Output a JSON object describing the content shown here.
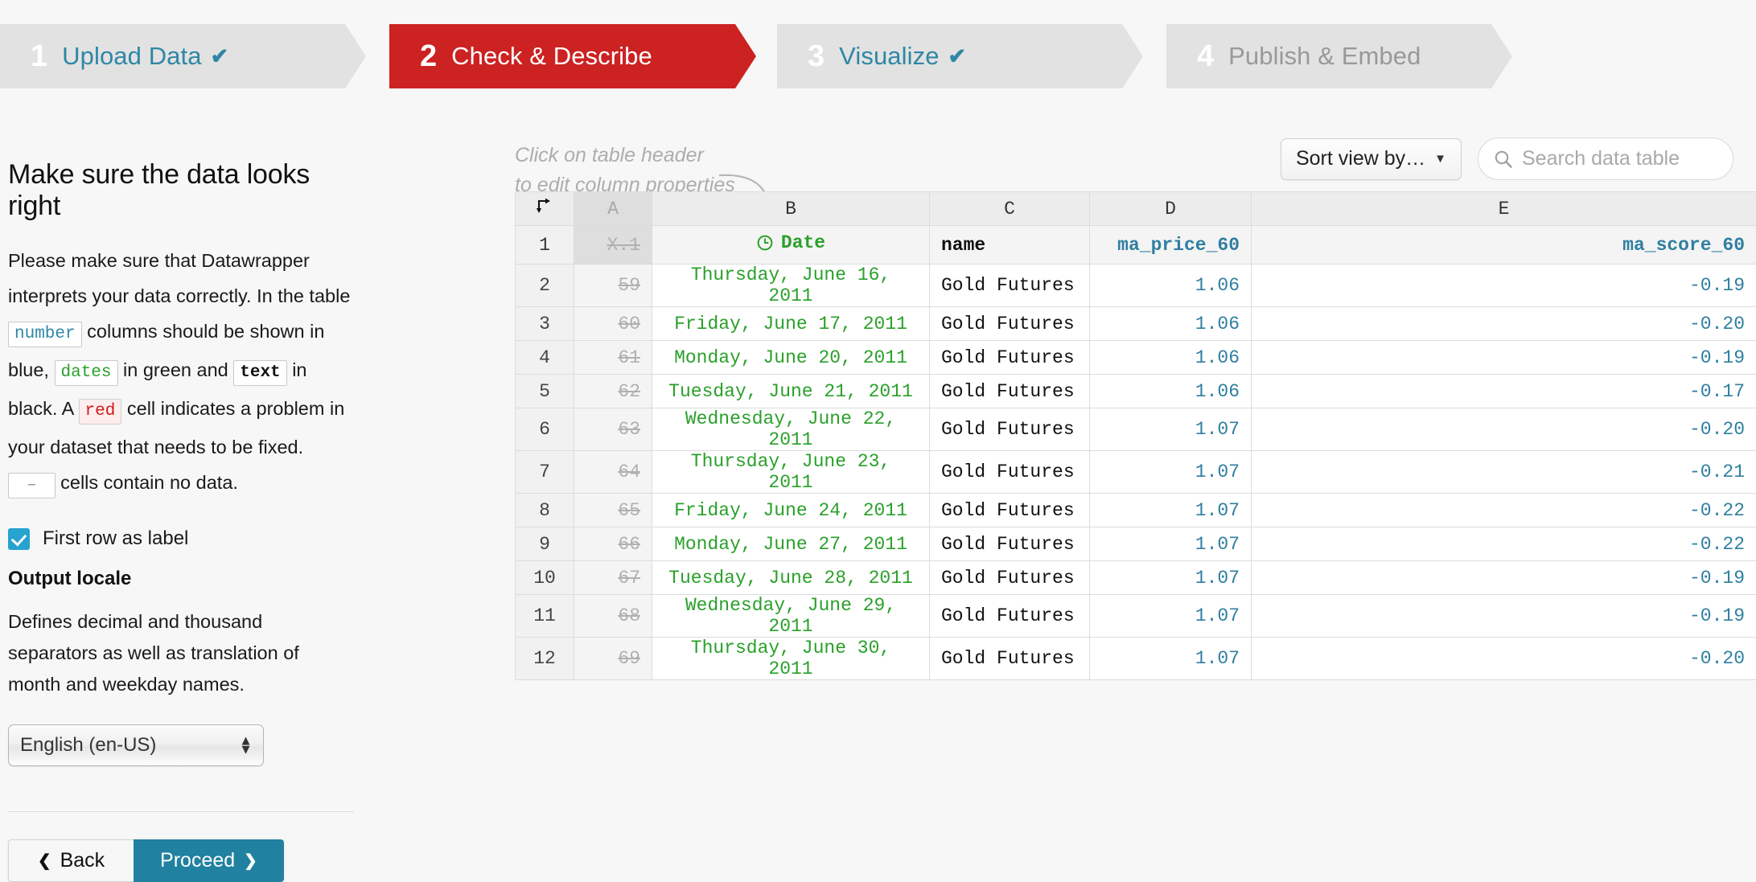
{
  "steps": [
    {
      "num": "1",
      "label": "Upload Data",
      "check": "✔",
      "state": "done"
    },
    {
      "num": "2",
      "label": "Check & Describe",
      "check": "",
      "state": "active"
    },
    {
      "num": "3",
      "label": "Visualize",
      "check": "✔",
      "state": "done"
    },
    {
      "num": "4",
      "label": "Publish & Embed",
      "check": "",
      "state": "disabled"
    }
  ],
  "sidebar": {
    "title": "Make sure the data looks right",
    "para": {
      "p1": "Please make sure that Datawrapper interprets your data correctly. In the table ",
      "tag_number": "number",
      "p2": " columns should be shown in blue, ",
      "tag_dates": "dates",
      "p3": " in green and ",
      "tag_text": "text",
      "p4": " in black. A ",
      "tag_red": "red",
      "p5": " cell indicates a problem in your dataset that needs to be fixed. ",
      "tag_empty": "–",
      "p6": " cells contain no data."
    },
    "checkbox": {
      "label": "First row as label",
      "checked": true,
      "accent": "#27a3d0"
    },
    "subheading": "Output locale",
    "description": "Defines decimal and thousand separators as well as translation of month and weekday names.",
    "locale_value": "English (en-US)",
    "back_label": "Back",
    "proceed_label": "Proceed",
    "back_icon": "❮",
    "proceed_icon": "❯"
  },
  "toolbar": {
    "hint_line1": "Click on table header",
    "hint_line2": "to edit column properties",
    "sort_label": "Sort view by…",
    "sort_caret": "▼",
    "search_placeholder": "Search data table",
    "search_value": ""
  },
  "table": {
    "column_letters": [
      "",
      "A",
      "B",
      "C",
      "D",
      "E"
    ],
    "header_row_index": "1",
    "header_cells": {
      "a": "X.1",
      "b": "Date",
      "c": "name",
      "d": "ma_price_60",
      "e": "ma_score_60"
    },
    "rows": [
      {
        "n": "2",
        "a": "59",
        "b": "Thursday, June 16, 2011",
        "c": "Gold Futures",
        "d": "1.06",
        "e": "-0.19"
      },
      {
        "n": "3",
        "a": "60",
        "b": "Friday, June 17, 2011",
        "c": "Gold Futures",
        "d": "1.06",
        "e": "-0.20"
      },
      {
        "n": "4",
        "a": "61",
        "b": "Monday, June 20, 2011",
        "c": "Gold Futures",
        "d": "1.06",
        "e": "-0.19"
      },
      {
        "n": "5",
        "a": "62",
        "b": "Tuesday, June 21, 2011",
        "c": "Gold Futures",
        "d": "1.06",
        "e": "-0.17"
      },
      {
        "n": "6",
        "a": "63",
        "b": "Wednesday, June 22, 2011",
        "c": "Gold Futures",
        "d": "1.07",
        "e": "-0.20"
      },
      {
        "n": "7",
        "a": "64",
        "b": "Thursday, June 23, 2011",
        "c": "Gold Futures",
        "d": "1.07",
        "e": "-0.21"
      },
      {
        "n": "8",
        "a": "65",
        "b": "Friday, June 24, 2011",
        "c": "Gold Futures",
        "d": "1.07",
        "e": "-0.22"
      },
      {
        "n": "9",
        "a": "66",
        "b": "Monday, June 27, 2011",
        "c": "Gold Futures",
        "d": "1.07",
        "e": "-0.22"
      },
      {
        "n": "10",
        "a": "67",
        "b": "Tuesday, June 28, 2011",
        "c": "Gold Futures",
        "d": "1.07",
        "e": "-0.19"
      },
      {
        "n": "11",
        "a": "68",
        "b": "Wednesday, June 29, 2011",
        "c": "Gold Futures",
        "d": "1.07",
        "e": "-0.19"
      },
      {
        "n": "12",
        "a": "69",
        "b": "Thursday, June 30, 2011",
        "c": "Gold Futures",
        "d": "1.07",
        "e": "-0.20"
      }
    ]
  },
  "colors": {
    "active_step": "#cc2222",
    "link_blue": "#2f87a5",
    "number_blue": "#2f7fa0",
    "date_green": "#2aa02a",
    "error_red": "#d01a1a",
    "proceed_teal": "#2181a0"
  }
}
